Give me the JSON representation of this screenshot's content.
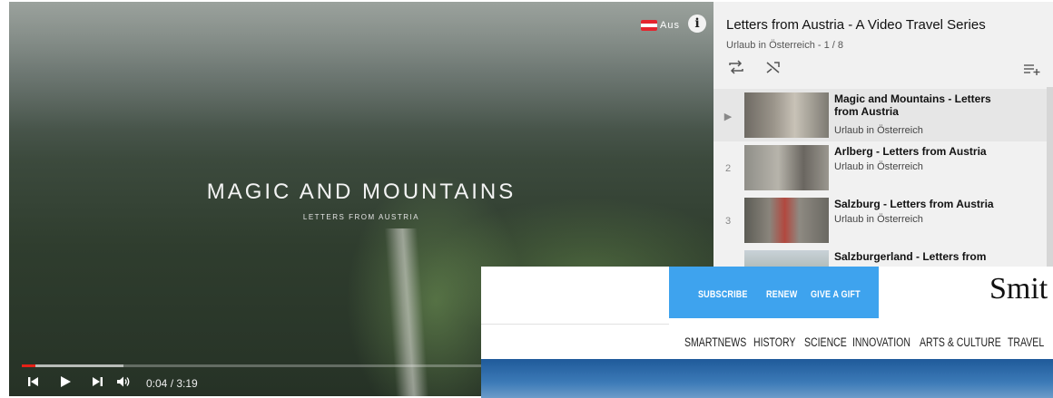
{
  "player": {
    "brand_label": "Aus",
    "video_title": "MAGIC AND MOUNTAINS",
    "video_subtitle": "LETTERS FROM AUSTRIA",
    "time_display": "0:04 / 3:19",
    "progress_played_fraction": 0.02,
    "progress_loaded_fraction": 0.15,
    "icons": [
      "austria-flag-icon",
      "info-icon",
      "skip-previous-icon",
      "play-icon",
      "skip-next-icon",
      "volume-icon"
    ]
  },
  "playlist": {
    "title": "Letters from Austria - A Video Travel Series",
    "meta": "Urlaub in Österreich - 1 / 8",
    "icons": [
      "loop-icon",
      "shuffle-icon",
      "add-to-playlist-icon"
    ],
    "items": [
      {
        "index": "▶",
        "title": "Magic and Mountains - Letters from Austria",
        "channel": "Urlaub in Österreich"
      },
      {
        "index": "2",
        "title": "Arlberg - Letters from Austria",
        "channel": "Urlaub in Österreich"
      },
      {
        "index": "3",
        "title": "Salzburg - Letters from Austria",
        "channel": "Urlaub in Österreich"
      },
      {
        "index": "",
        "title": "Salzburgerland - Letters from",
        "channel": ""
      }
    ]
  },
  "site": {
    "cta": [
      "SUBSCRIBE",
      "RENEW",
      "GIVE A GIFT"
    ],
    "brand": "Smit",
    "nav": [
      "SMARTNEWS",
      "HISTORY",
      "SCIENCE",
      "INNOVATION",
      "ARTS & CULTURE",
      "TRAVEL"
    ],
    "colors": {
      "cta_bg": "#3ea3ee",
      "band": "#2f6fae"
    }
  }
}
